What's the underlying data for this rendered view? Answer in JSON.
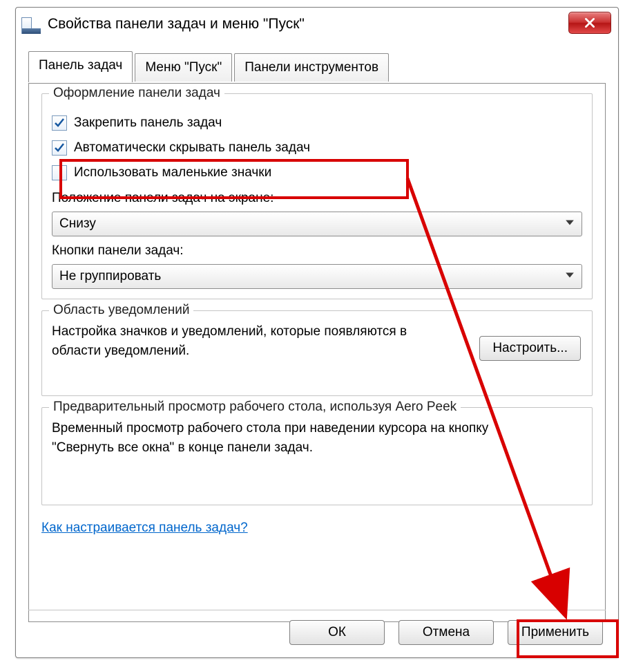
{
  "window": {
    "title": "Свойства панели задач и меню \"Пуск\""
  },
  "tabs": {
    "items": [
      {
        "label": "Панель задач",
        "active": true
      },
      {
        "label": "Меню \"Пуск\"",
        "active": false
      },
      {
        "label": "Панели инструментов",
        "active": false
      }
    ]
  },
  "group_appearance": {
    "legend": "Оформление панели задач",
    "chk_lock": "Закрепить панель задач",
    "chk_autohide": "Автоматически скрывать панель задач",
    "chk_small": "Использовать маленькие значки",
    "label_position": "Положение панели задач на экране:",
    "position_value": "Снизу",
    "label_buttons": "Кнопки панели задач:",
    "buttons_value": "Не группировать"
  },
  "group_notify": {
    "legend": "Область уведомлений",
    "text": "Настройка значков и уведомлений, которые появляются в области уведомлений.",
    "button": "Настроить..."
  },
  "group_peek": {
    "legend": "Предварительный просмотр рабочего стола, используя Aero Peek",
    "text": "Временный просмотр рабочего стола при наведении курсора на кнопку \"Свернуть все окна\" в конце панели задач."
  },
  "help_link": "Как настраивается панель задач?",
  "buttons": {
    "ok": "ОК",
    "cancel": "Отмена",
    "apply": "Применить"
  }
}
